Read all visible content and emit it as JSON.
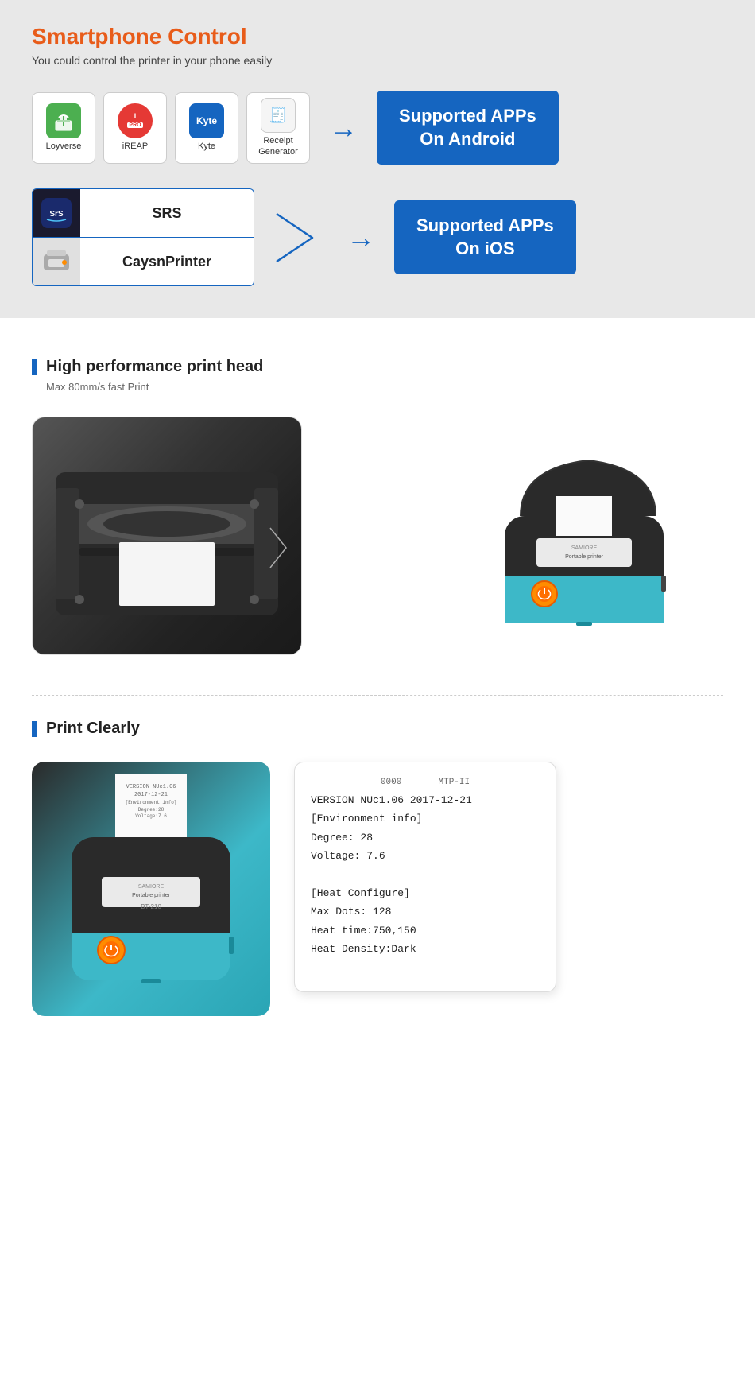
{
  "smartphone_section": {
    "title": "Smartphone Control",
    "subtitle": "You could control the printer in your phone easily",
    "android_apps": [
      {
        "name": "Loyverse",
        "icon_type": "loyverse"
      },
      {
        "name": "iREAP",
        "icon_type": "ireap"
      },
      {
        "name": "Kyte",
        "icon_type": "kyte"
      },
      {
        "name": "Receipt\nGenerator",
        "icon_type": "receipt"
      }
    ],
    "supported_android_label": "Supported APPs\nOn Android",
    "ios_apps": [
      {
        "name": "SRS",
        "icon_type": "srs"
      },
      {
        "name": "CaysnPrinter",
        "icon_type": "printer"
      }
    ],
    "supported_ios_label": "Supported APPs\nOn iOS"
  },
  "print_head_section": {
    "title": "High performance print head",
    "subtitle": "Max 80mm/s fast Print"
  },
  "print_clearly_section": {
    "title": "Print Clearly",
    "receipt_lines": [
      "VERSION NUc1.06 2017-12-21",
      "[Environment info]",
      "Degree: 28",
      "Voltage: 7.6",
      "",
      "[Heat Configure]",
      "Max Dots: 128",
      "Heat time:750,150",
      "Heat Density:Dark"
    ]
  }
}
